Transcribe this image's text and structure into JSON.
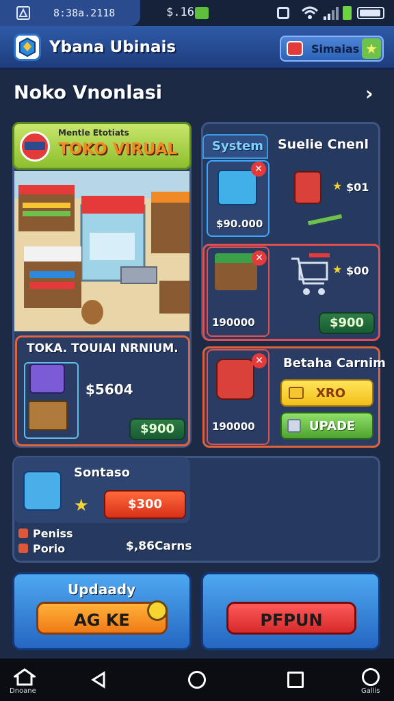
{
  "status": {
    "time": "8:38a.2118",
    "battery_text": "$.16"
  },
  "header": {
    "title": "Ybana Ubinais",
    "button_label": "Simaias"
  },
  "section": {
    "title": "Noko Vnonlasi"
  },
  "shop_banner": {
    "subtitle": "Mentle Etotiats",
    "title": "TOKO VIRUAL"
  },
  "toko_panel": {
    "title": "TOKA. TOUIAI NRNIUM.",
    "price": "$5604",
    "button_label": "$900"
  },
  "system_panel": {
    "tab_label": "System",
    "header": "Suelie Cnenl",
    "items": [
      {
        "price": "$90.000",
        "side_price": "$01"
      },
      {
        "price": "190000",
        "side_price": "$00",
        "button_label": "$900"
      }
    ]
  },
  "upgrade_panel": {
    "title": "Betaha Carnim",
    "price": "190000",
    "buy_label": "XRO",
    "upgrade_label": "UPADE"
  },
  "bottom_panel": {
    "title": "Sontaso",
    "price_button": "$300",
    "stats": [
      "Peniss",
      "Porio"
    ],
    "total": "$,86Carns"
  },
  "actions": {
    "left_title": "Updaady",
    "left_button": "AG KE",
    "right_button": "PFPUN"
  },
  "navbar": {
    "home_label": "Dnoane",
    "right_label": "Gallis"
  },
  "colors": {
    "accent_orange": "#f08a24",
    "accent_red": "#e53a3a",
    "accent_green": "#6cc24a",
    "accent_yellow": "#f6d531"
  }
}
